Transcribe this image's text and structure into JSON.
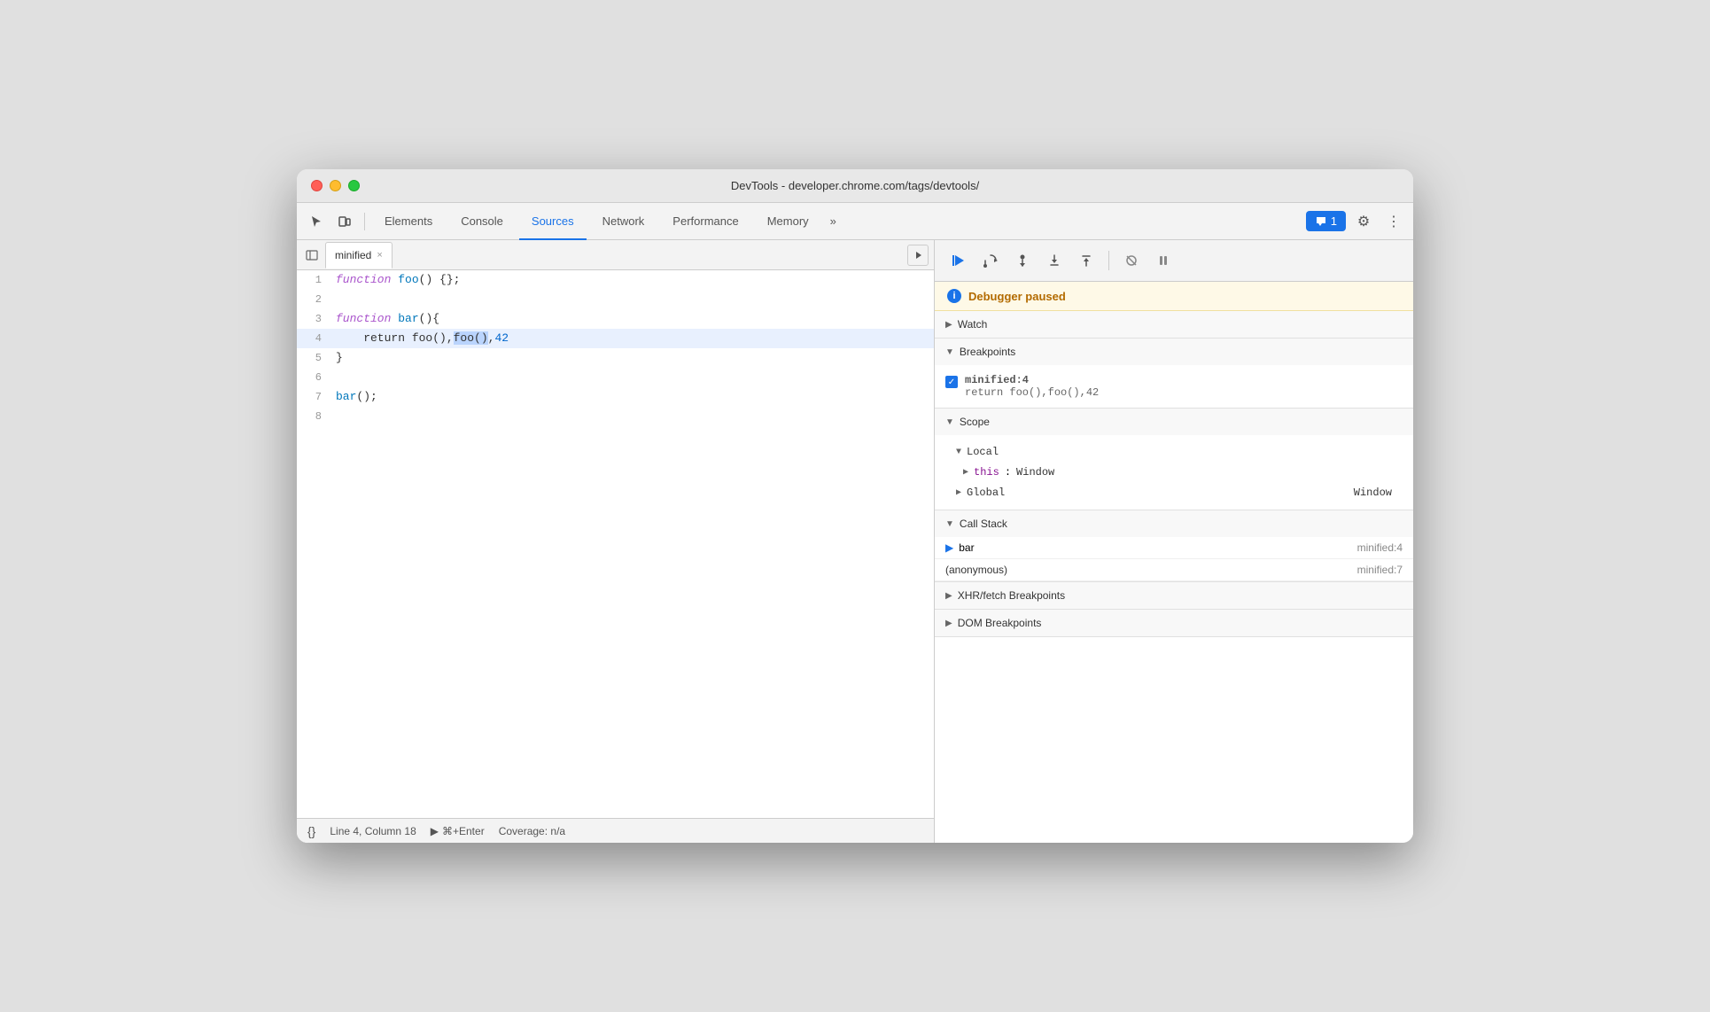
{
  "window": {
    "title": "DevTools - developer.chrome.com/tags/devtools/"
  },
  "tabs": {
    "items": [
      {
        "label": "Elements",
        "active": false
      },
      {
        "label": "Console",
        "active": false
      },
      {
        "label": "Sources",
        "active": true
      },
      {
        "label": "Network",
        "active": false
      },
      {
        "label": "Performance",
        "active": false
      },
      {
        "label": "Memory",
        "active": false
      }
    ],
    "more": "»",
    "chat_label": "1",
    "settings_icon": "⚙",
    "dots_icon": "⋮"
  },
  "file_tab": {
    "name": "minified",
    "close": "×"
  },
  "code": {
    "lines": [
      {
        "num": 1,
        "content": "function foo() {};"
      },
      {
        "num": 2,
        "content": ""
      },
      {
        "num": 3,
        "content": "function bar(){"
      },
      {
        "num": 4,
        "content": "    return foo(),foo(),42",
        "highlighted": true
      },
      {
        "num": 5,
        "content": "}"
      },
      {
        "num": 6,
        "content": ""
      },
      {
        "num": 7,
        "content": "bar();"
      },
      {
        "num": 8,
        "content": ""
      }
    ]
  },
  "status_bar": {
    "format_icon": "{}",
    "position": "Line 4, Column 18",
    "run_label": "⌘+Enter",
    "coverage": "Coverage: n/a"
  },
  "debug_toolbar": {
    "resume_icon": "▶",
    "step_over_icon": "↩",
    "step_icon": "↓",
    "step_into_icon": "↑",
    "step_out_icon": "→",
    "deactivate_icon": "⊘",
    "pause_icon": "⏸"
  },
  "debugger_paused": {
    "label": "Debugger paused"
  },
  "panels": {
    "watch": {
      "label": "Watch",
      "expanded": false
    },
    "breakpoints": {
      "label": "Breakpoints",
      "expanded": true,
      "items": [
        {
          "location": "minified:4",
          "code": "return foo(),foo(),42",
          "checked": true
        }
      ]
    },
    "scope": {
      "label": "Scope",
      "expanded": true,
      "sections": [
        {
          "label": "Local",
          "expanded": true,
          "items": [
            {
              "key": "this",
              "value": "Window",
              "expandable": true
            }
          ]
        },
        {
          "label": "Global",
          "expanded": false,
          "value": "Window"
        }
      ]
    },
    "call_stack": {
      "label": "Call Stack",
      "expanded": true,
      "items": [
        {
          "name": "bar",
          "location": "minified:4",
          "active": true
        },
        {
          "name": "(anonymous)",
          "location": "minified:7",
          "active": false
        }
      ]
    },
    "xhr_breakpoints": {
      "label": "XHR/fetch Breakpoints",
      "expanded": false
    },
    "dom_breakpoints": {
      "label": "DOM Breakpoints",
      "expanded": false
    }
  }
}
